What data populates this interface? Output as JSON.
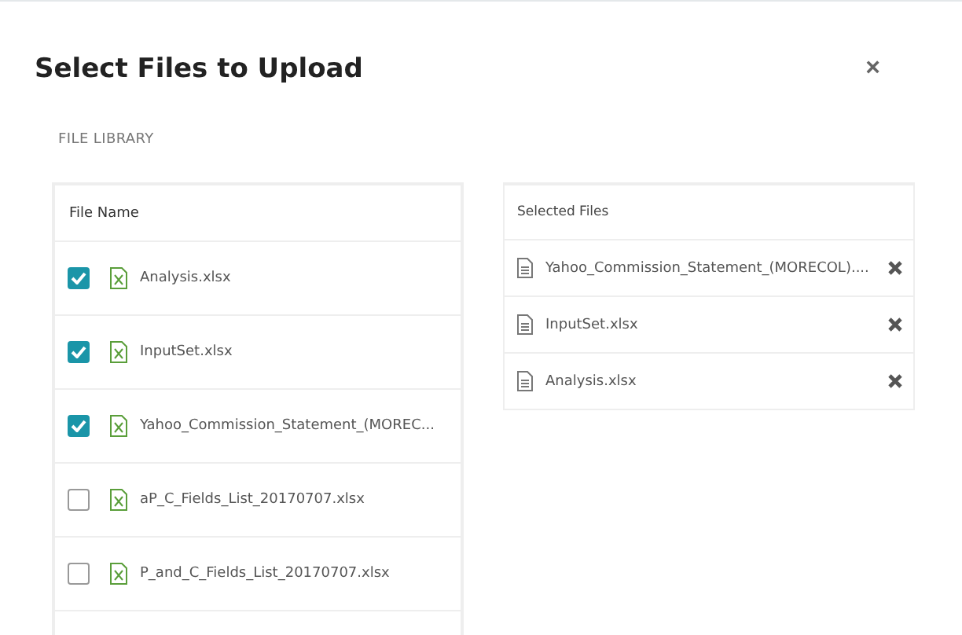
{
  "dialog": {
    "title": "Select Files to Upload",
    "close": "×"
  },
  "library": {
    "heading": "FILE LIBRARY",
    "column": "File Name",
    "files": [
      {
        "name": "Analysis.xlsx",
        "checked": true
      },
      {
        "name": "InputSet.xlsx",
        "checked": true
      },
      {
        "name": "Yahoo_Commission_Statement_(MOREC...",
        "checked": true
      },
      {
        "name": "aP_C_Fields_List_20170707.xlsx",
        "checked": false
      },
      {
        "name": "P_and_C_Fields_List_20170707.xlsx",
        "checked": false
      }
    ]
  },
  "selected": {
    "heading": "Selected Files",
    "files": [
      {
        "name": "Yahoo_Commission_Statement_(MORECOL)...."
      },
      {
        "name": "InputSet.xlsx"
      },
      {
        "name": "Analysis.xlsx"
      }
    ]
  }
}
